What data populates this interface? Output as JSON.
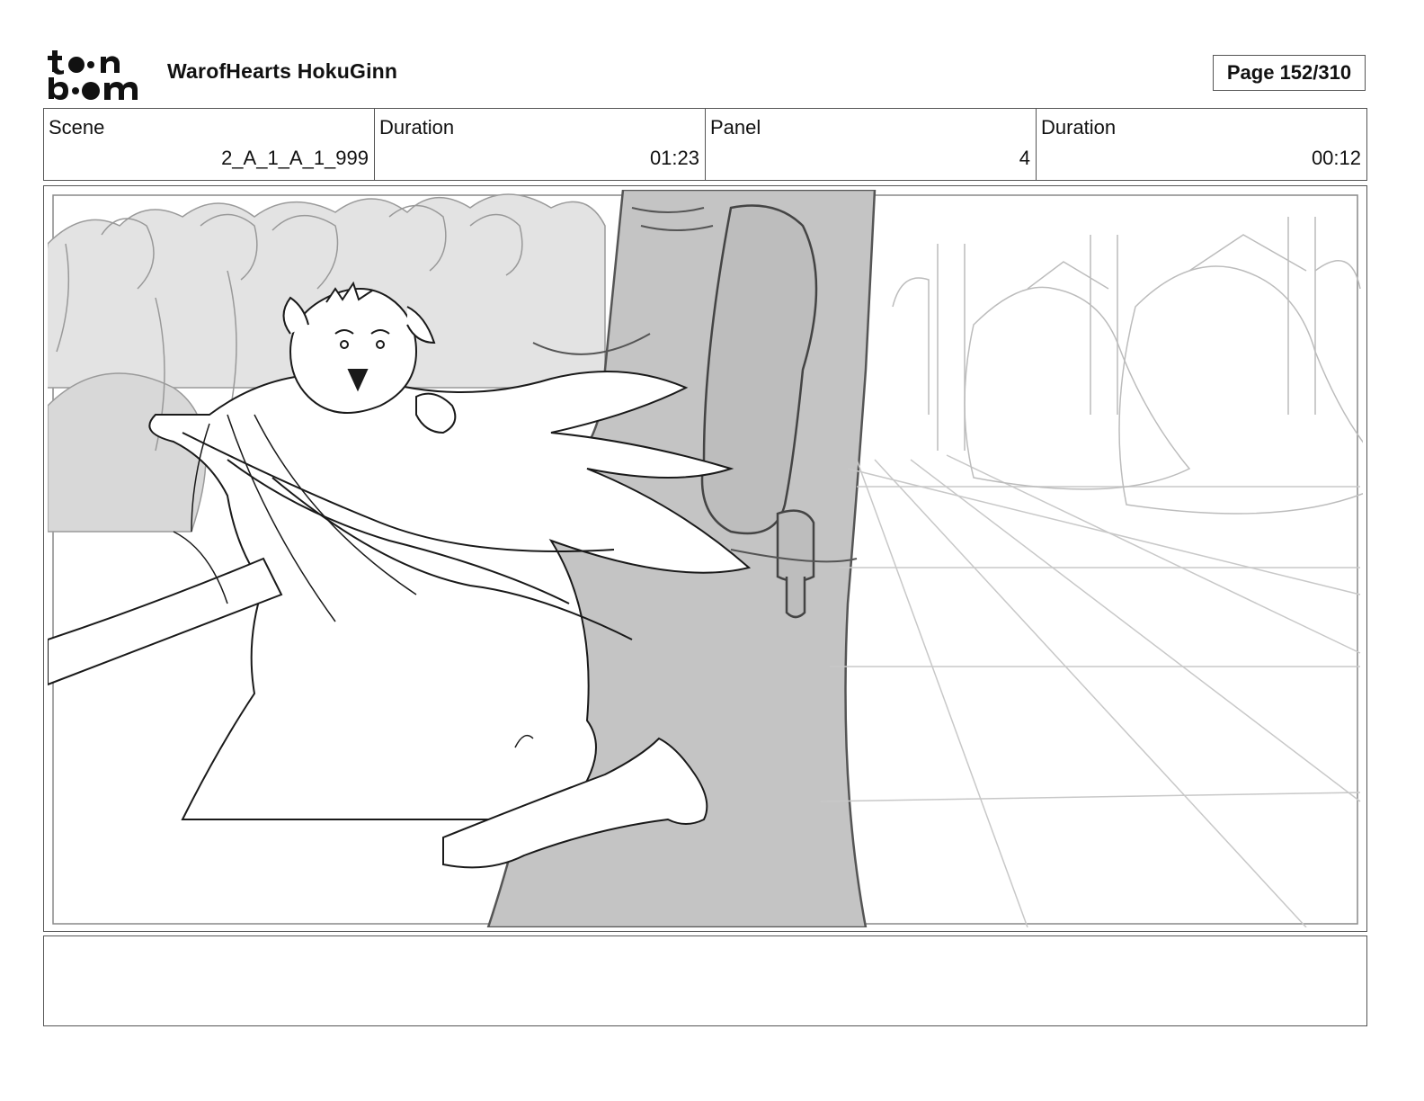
{
  "header": {
    "logo_text": "toon boom",
    "project_title": "WarofHearts HokuGinn",
    "page_label": "Page 152/310"
  },
  "info": {
    "scene_label": "Scene",
    "scene_value": "2_A_1_A_1_999",
    "scene_duration_label": "Duration",
    "scene_duration_value": "01:23",
    "panel_label": "Panel",
    "panel_value": "4",
    "panel_duration_label": "Duration",
    "panel_duration_value": "00:12"
  },
  "notes": {
    "text": ""
  },
  "colors": {
    "frame_border": "#555555",
    "sketch_light": "#e6e6e6",
    "sketch_mid": "#c4c4c4",
    "sketch_line": "#1a1a1a"
  }
}
